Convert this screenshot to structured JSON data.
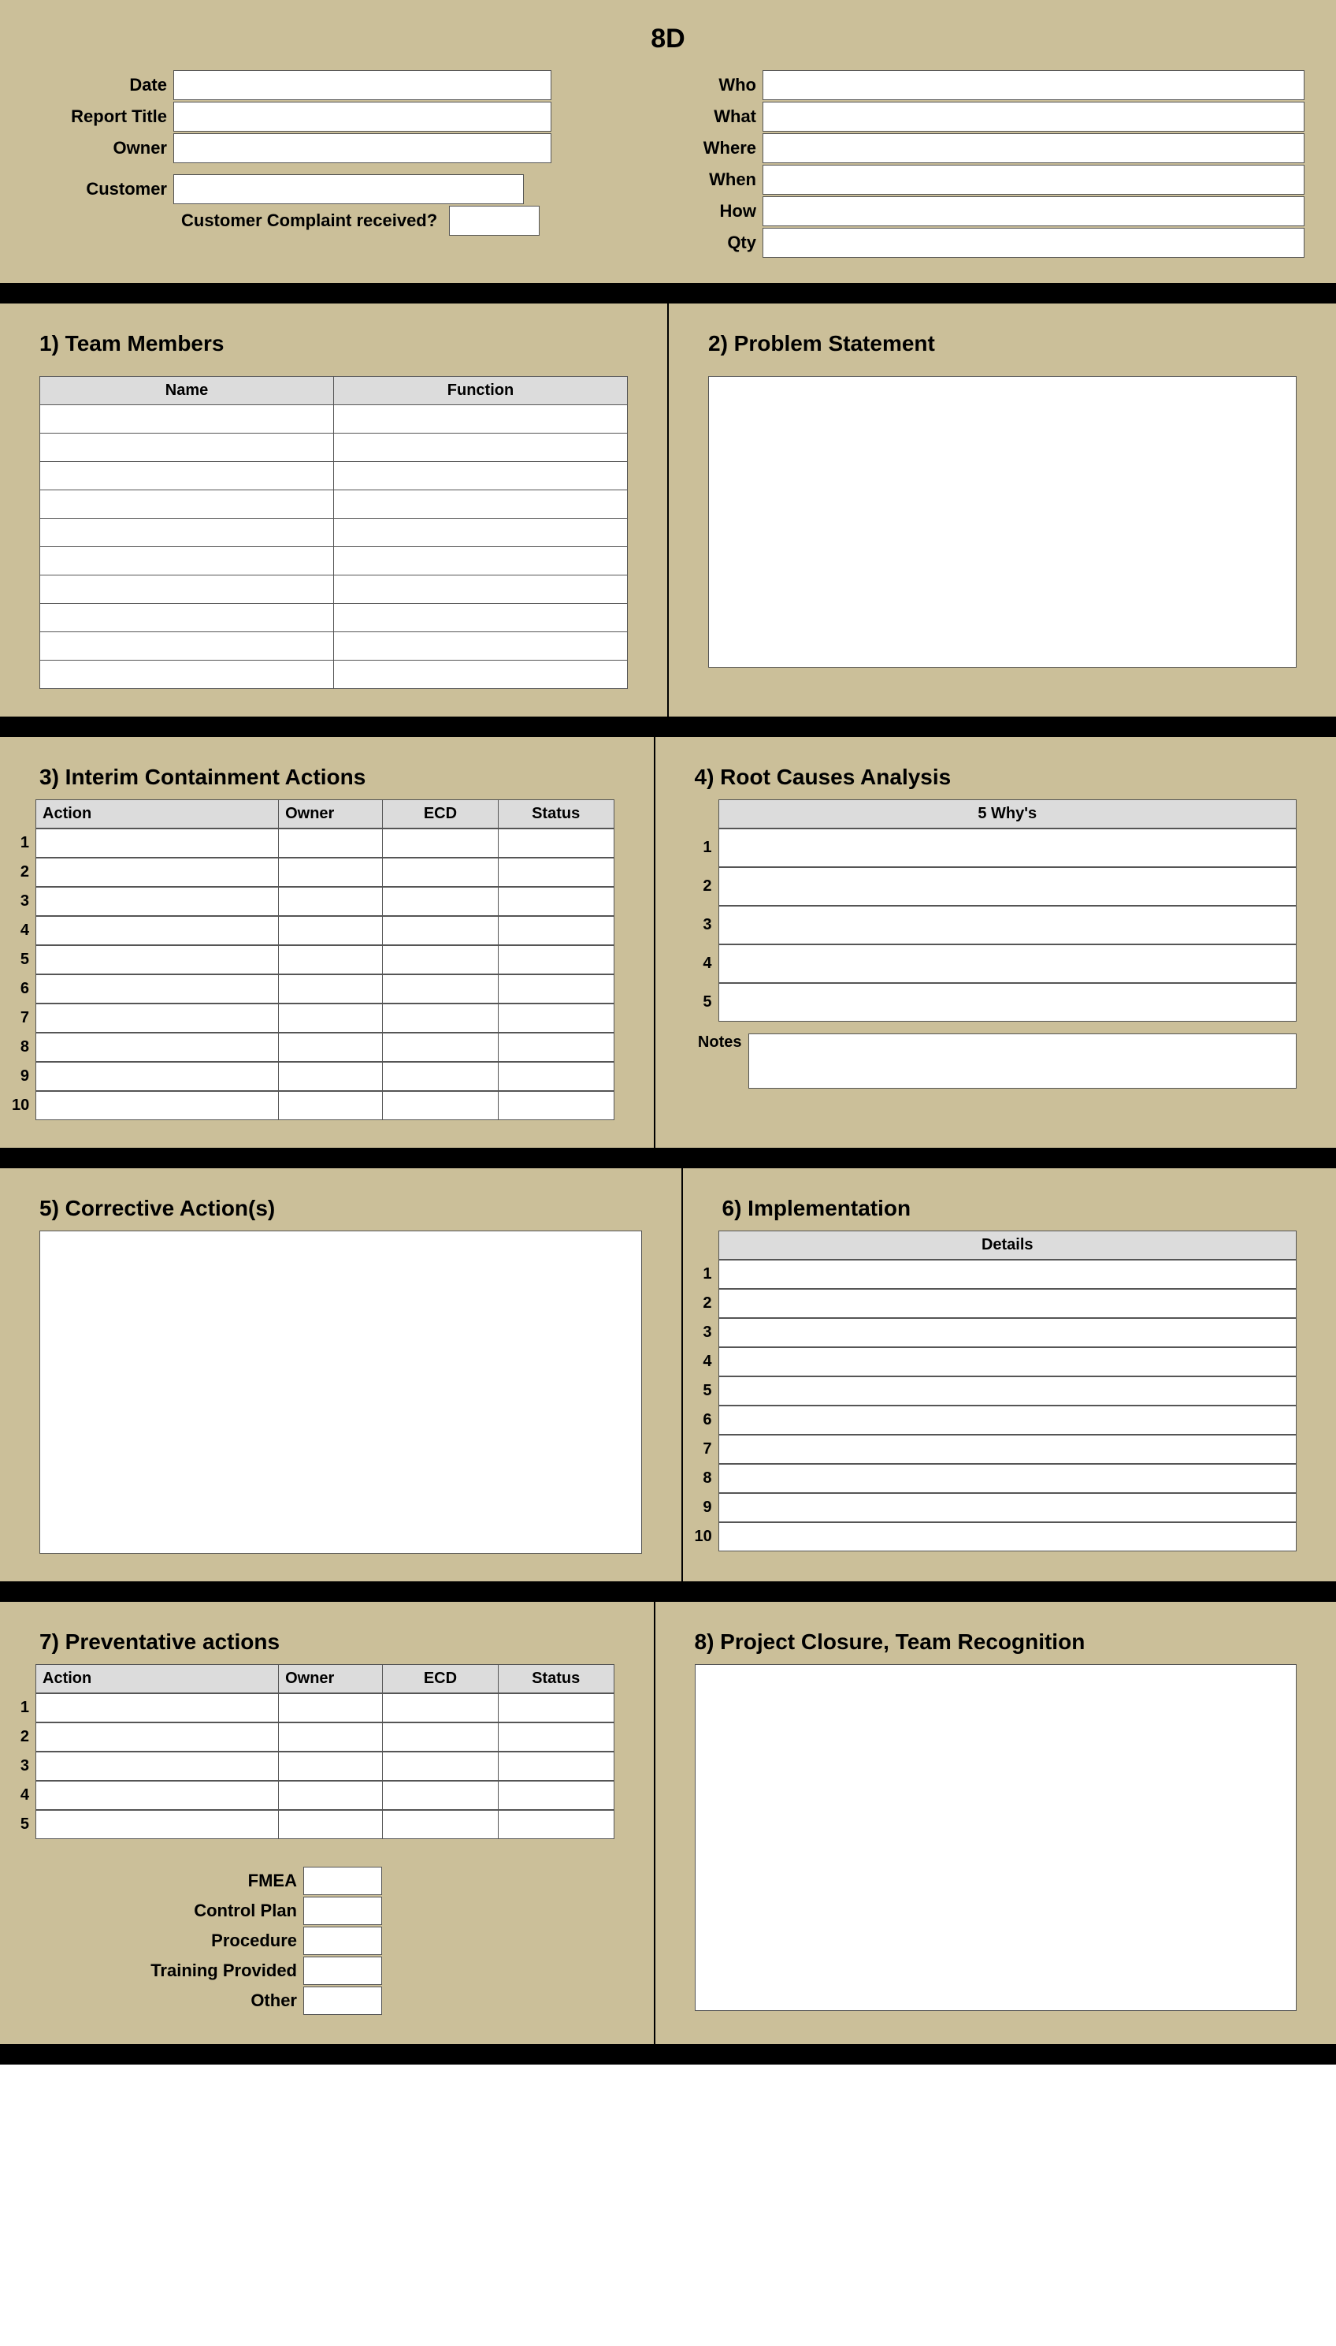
{
  "title": "8D",
  "header": {
    "left": {
      "date_label": "Date",
      "report_title_label": "Report Title",
      "owner_label": "Owner",
      "customer_label": "Customer",
      "complaint_label": "Customer Complaint received?"
    },
    "right": {
      "who_label": "Who",
      "what_label": "What",
      "where_label": "Where",
      "when_label": "When",
      "how_label": "How",
      "qty_label": "Qty"
    }
  },
  "sections": {
    "team": {
      "heading": "1) Team Members",
      "name_header": "Name",
      "function_header": "Function"
    },
    "problem": {
      "heading": "2) Problem Statement"
    },
    "interim": {
      "heading": "3) Interim Containment Actions",
      "action_header": "Action",
      "owner_header": "Owner",
      "ecd_header": "ECD",
      "status_header": "Status",
      "rows": [
        "1",
        "2",
        "3",
        "4",
        "5",
        "6",
        "7",
        "8",
        "9",
        "10"
      ]
    },
    "root": {
      "heading": "4) Root Causes Analysis",
      "whys_header": "5 Why's",
      "whys_rows": [
        "1",
        "2",
        "3",
        "4",
        "5"
      ],
      "notes_label": "Notes"
    },
    "corrective": {
      "heading": "5) Corrective Action(s)"
    },
    "impl": {
      "heading": "6) Implementation",
      "details_header": "Details",
      "rows": [
        "1",
        "2",
        "3",
        "4",
        "5",
        "6",
        "7",
        "8",
        "9",
        "10"
      ]
    },
    "prevent": {
      "heading": "7) Preventative actions",
      "action_header": "Action",
      "owner_header": "Owner",
      "ecd_header": "ECD",
      "status_header": "Status",
      "rows": [
        "1",
        "2",
        "3",
        "4",
        "5"
      ],
      "checks": {
        "fmea": "FMEA",
        "control": "Control Plan",
        "procedure": "Procedure",
        "training": "Training Provided",
        "other": "Other"
      }
    },
    "closure": {
      "heading": "8) Project Closure, Team Recognition"
    }
  }
}
